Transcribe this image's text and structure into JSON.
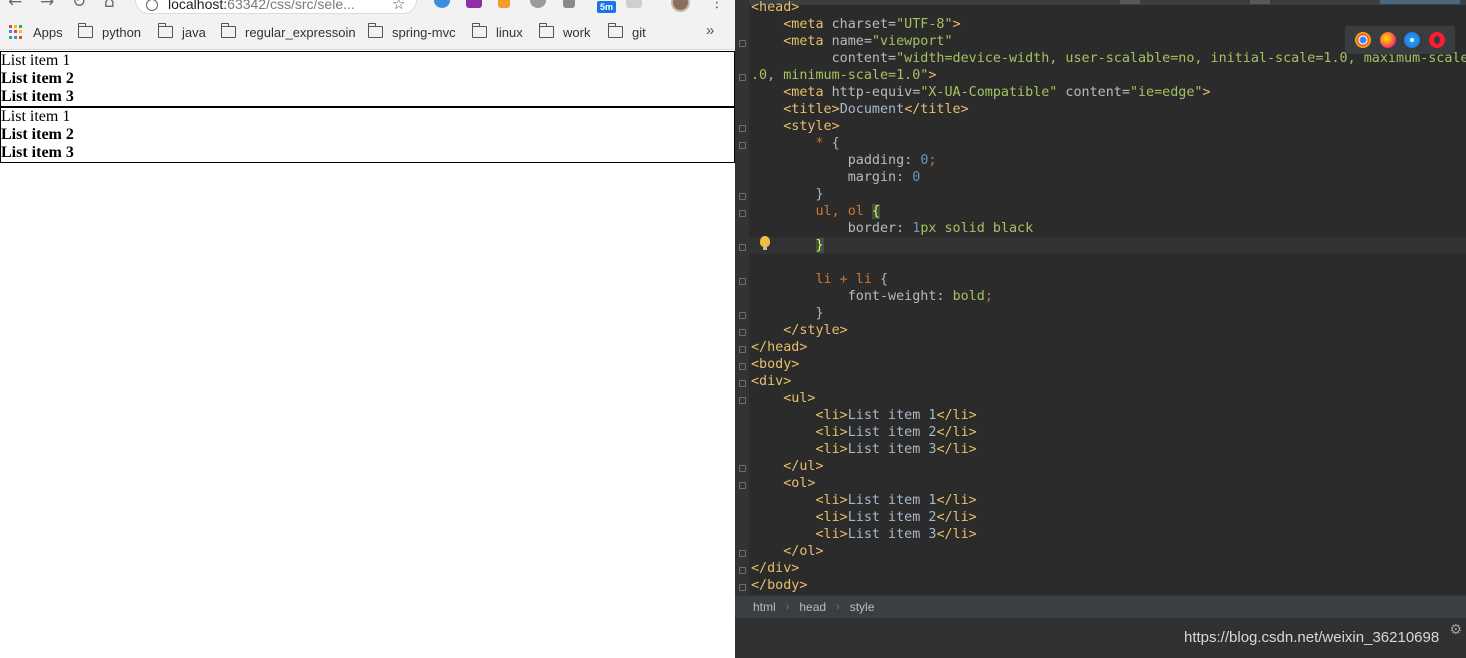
{
  "browser": {
    "url_host": "localhost:",
    "url_path": "63342/css/src/sele...",
    "ext_badge": "5m",
    "bookmarks": {
      "apps": "Apps",
      "folders": [
        "python",
        "java",
        "regular_expressoin",
        "spring-mvc",
        "linux",
        "work",
        "git"
      ],
      "more": "»"
    },
    "icons": {
      "back": "←",
      "forward": "→",
      "reload": "↻",
      "home": "⌂",
      "star": "☆",
      "menu": "⋮"
    },
    "page": {
      "ul_items": [
        "List item 1",
        "List item 2",
        "List item 3"
      ],
      "ol_items": [
        "List item 1",
        "List item 2",
        "List item 3"
      ]
    }
  },
  "ide": {
    "breadcrumbs": [
      "html",
      "head",
      "style"
    ],
    "breadcrumb_sep": "›",
    "gear": "⚙",
    "browser_icons": [
      "chrome-icon",
      "firefox-icon",
      "safari-icon",
      "opera-icon"
    ],
    "colors": {
      "tag": "#e8bf6a",
      "string": "#a5c261",
      "selector": "#cc7832",
      "number": "#6897bb",
      "background": "#2b2b2b"
    }
  },
  "watermark": "https://blog.csdn.net/weixin_36210698"
}
